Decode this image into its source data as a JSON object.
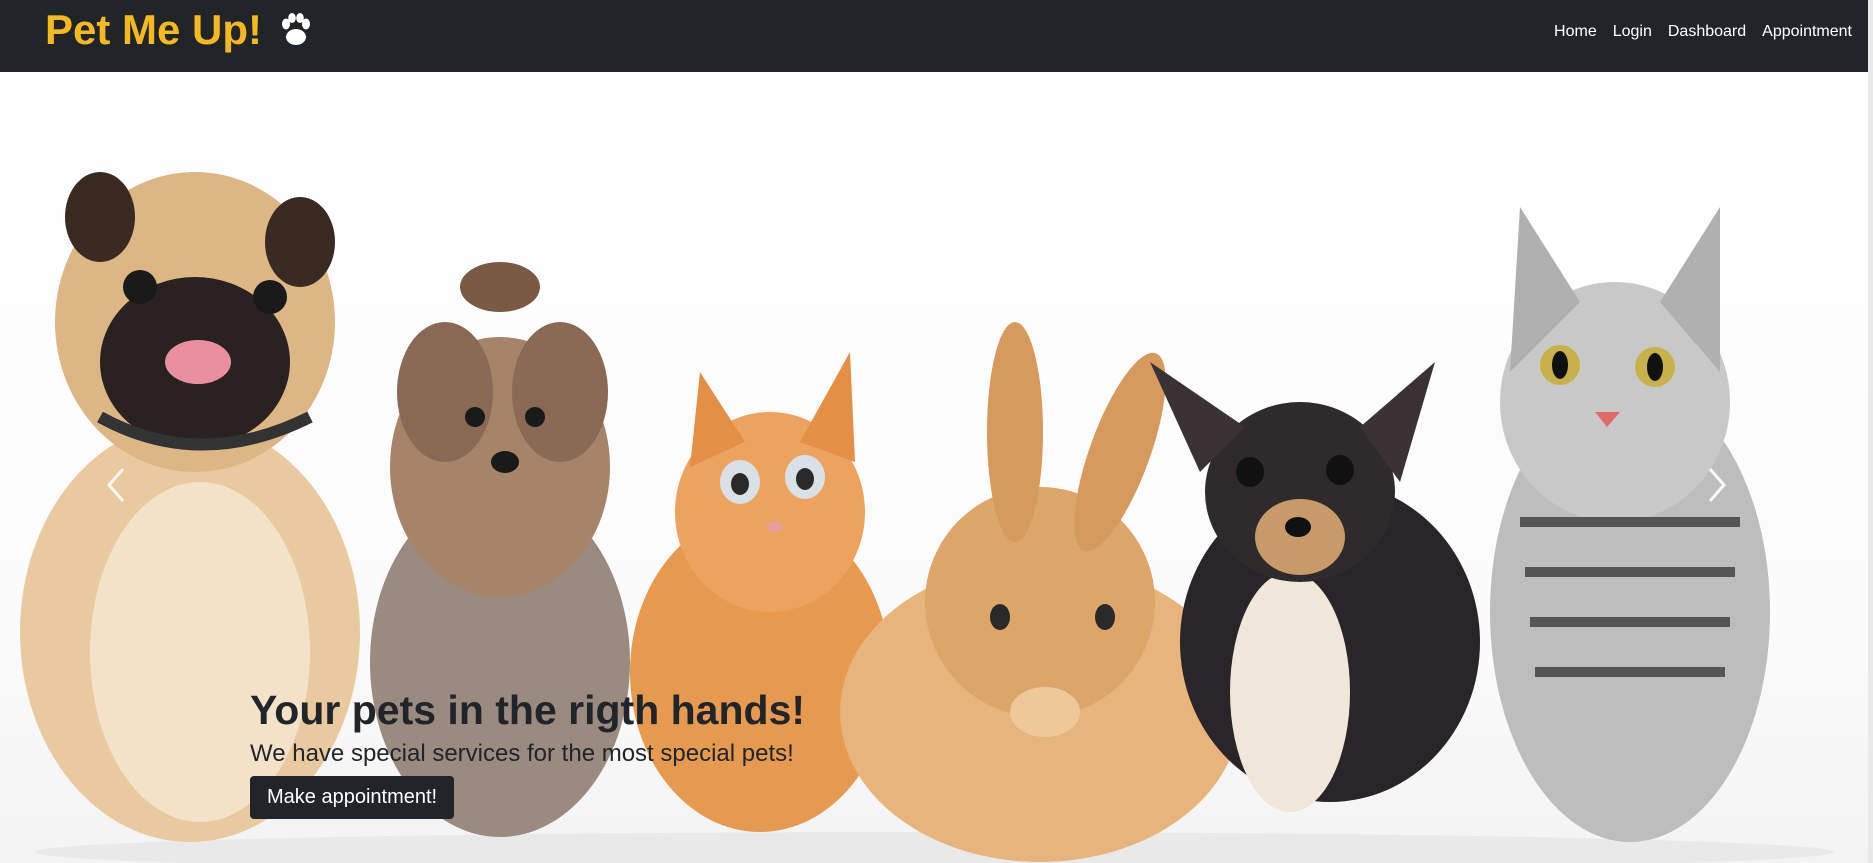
{
  "navbar": {
    "brand": "Pet Me Up!",
    "brand_icon": "paw-icon",
    "links": [
      "Home",
      "Login",
      "Dashboard",
      "Appointment"
    ]
  },
  "hero": {
    "title": "Your pets in the rigth hands!",
    "subtitle": "We have special services for the most special pets!",
    "cta_label": "Make appointment!",
    "prev_icon": "chevron-left-icon",
    "next_icon": "chevron-right-icon"
  },
  "colors": {
    "navbar_bg": "#212529",
    "brand": "#f5b920",
    "cta_bg": "#212529"
  }
}
